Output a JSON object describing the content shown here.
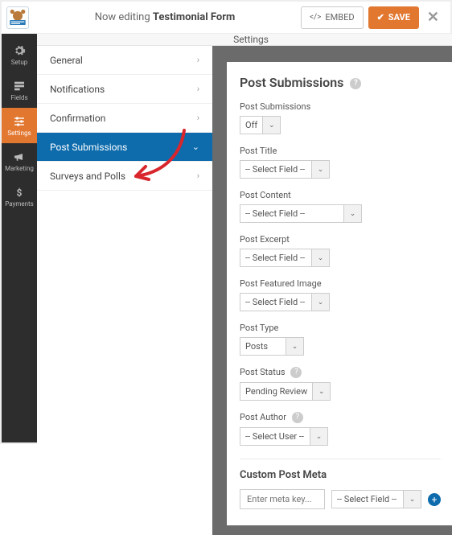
{
  "header": {
    "editing_prefix": "Now editing",
    "form_name": "Testimonial Form",
    "embed_label": "EMBED",
    "save_label": "SAVE"
  },
  "leftnav": {
    "items": [
      {
        "label": "Setup"
      },
      {
        "label": "Fields"
      },
      {
        "label": "Settings"
      },
      {
        "label": "Marketing"
      },
      {
        "label": "Payments"
      }
    ]
  },
  "subhead": "Settings",
  "menu": {
    "items": [
      {
        "label": "General"
      },
      {
        "label": "Notifications"
      },
      {
        "label": "Confirmation"
      },
      {
        "label": "Post Submissions"
      },
      {
        "label": "Surveys and Polls"
      }
    ]
  },
  "panel": {
    "title": "Post Submissions",
    "fields": {
      "toggle": {
        "label": "Post Submissions",
        "value": "Off"
      },
      "post_title": {
        "label": "Post Title",
        "value": "-- Select Field --"
      },
      "post_content": {
        "label": "Post Content",
        "value": "-- Select Field --"
      },
      "post_excerpt": {
        "label": "Post Excerpt",
        "value": "-- Select Field --"
      },
      "featured": {
        "label": "Post Featured Image",
        "value": "-- Select Field --"
      },
      "post_type": {
        "label": "Post Type",
        "value": "Posts"
      },
      "post_status": {
        "label": "Post Status",
        "value": "Pending Review"
      },
      "post_author": {
        "label": "Post Author",
        "value": "-- Select User --"
      }
    },
    "meta": {
      "heading": "Custom Post Meta",
      "placeholder": "Enter meta key...",
      "select": "-- Select Field --"
    }
  }
}
